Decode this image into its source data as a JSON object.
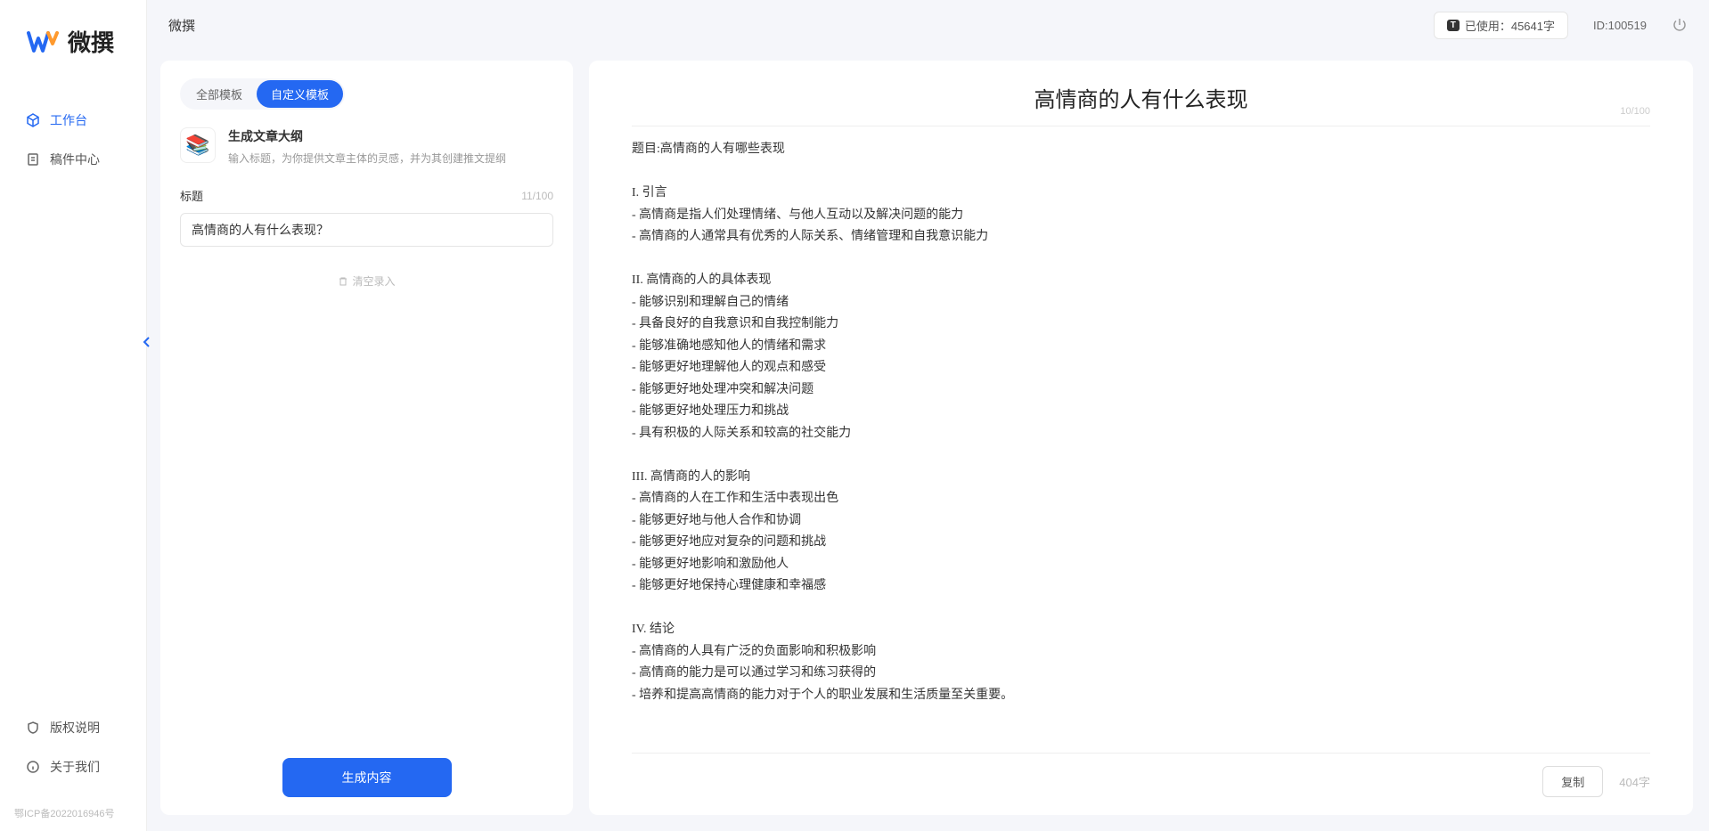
{
  "app": {
    "logo_text": "微撰"
  },
  "sidebar": {
    "items": [
      {
        "label": "工作台",
        "icon": "cube-icon",
        "active": true
      },
      {
        "label": "稿件中心",
        "icon": "doc-icon",
        "active": false
      }
    ],
    "bottom_items": [
      {
        "label": "版权说明",
        "icon": "shield-icon"
      },
      {
        "label": "关于我们",
        "icon": "info-icon"
      }
    ],
    "icp": "鄂ICP备2022016946号"
  },
  "header": {
    "title": "微撰",
    "usage_badge": "T",
    "usage_text": "已使用：45641字",
    "user_id": "ID:100519"
  },
  "editor": {
    "tabs": [
      {
        "label": "全部模板",
        "active": false
      },
      {
        "label": "自定义模板",
        "active": true
      }
    ],
    "template": {
      "name": "生成文章大纲",
      "desc": "输入标题，为你提供文章主体的灵感，并为其创建推文提纲"
    },
    "title_label": "标题",
    "title_count": "11/100",
    "title_value": "高情商的人有什么表现？",
    "clear_label": "清空录入",
    "generate_label": "生成内容"
  },
  "doc": {
    "title": "高情商的人有什么表现",
    "title_count": "10/100",
    "body": "题目:高情商的人有哪些表现\n\nI. 引言\n- 高情商是指人们处理情绪、与他人互动以及解决问题的能力\n- 高情商的人通常具有优秀的人际关系、情绪管理和自我意识能力\n\nII. 高情商的人的具体表现\n- 能够识别和理解自己的情绪\n- 具备良好的自我意识和自我控制能力\n- 能够准确地感知他人的情绪和需求\n- 能够更好地理解他人的观点和感受\n- 能够更好地处理冲突和解决问题\n- 能够更好地处理压力和挑战\n- 具有积极的人际关系和较高的社交能力\n\nIII. 高情商的人的影响\n- 高情商的人在工作和生活中表现出色\n- 能够更好地与他人合作和协调\n- 能够更好地应对复杂的问题和挑战\n- 能够更好地影响和激励他人\n- 能够更好地保持心理健康和幸福感\n\nIV. 结论\n- 高情商的人具有广泛的负面影响和积极影响\n- 高情商的能力是可以通过学习和练习获得的\n- 培养和提高高情商的能力对于个人的职业发展和生活质量至关重要。",
    "copy_label": "复制",
    "word_count": "404字"
  }
}
